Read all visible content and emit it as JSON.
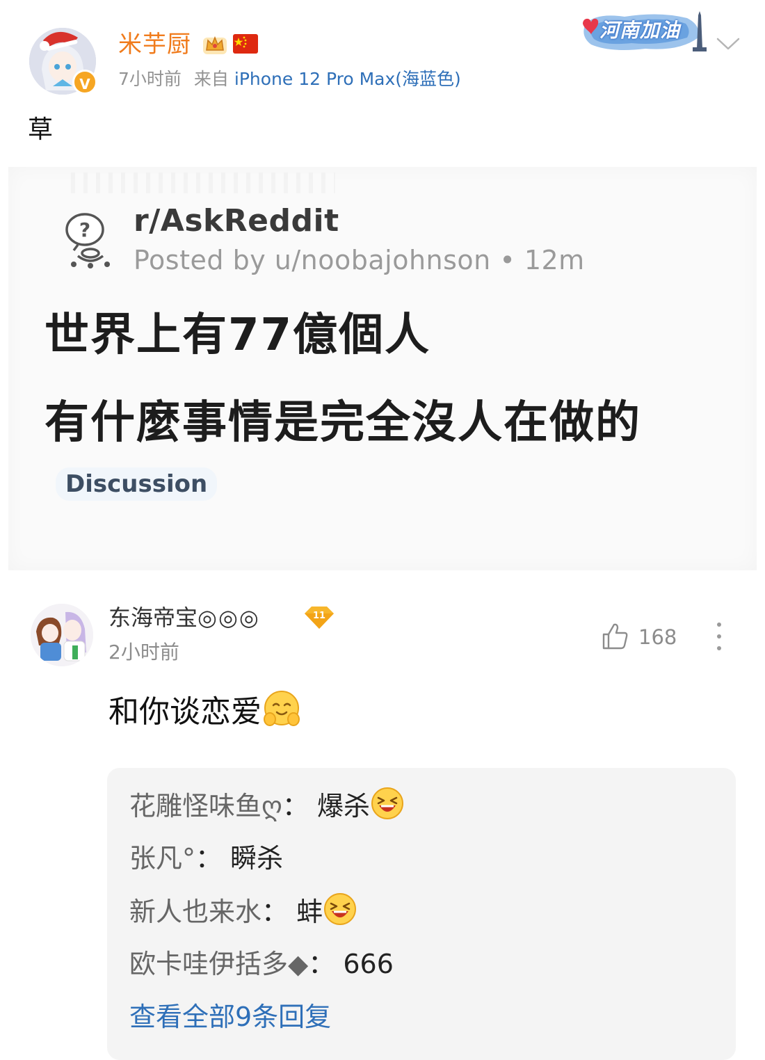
{
  "post": {
    "author": "米芋厨",
    "time": "7小时前",
    "source_prefix": "来自",
    "source_device": "iPhone 12 Pro Max(海蓝色)",
    "badge_text": "河南加油",
    "text": "草",
    "icons": [
      "crown-icon",
      "china-flag-icon",
      "chevron-down-icon",
      "verified-icon"
    ]
  },
  "reddit_image": {
    "subreddit": "r/AskReddit",
    "posted_by": "Posted by u/noobajohnson • 12m",
    "title_line1": "世界上有77億個人",
    "title_line2": "有什麼事情是完全沒人在做的",
    "flair": "Discussion"
  },
  "comment": {
    "author": "东海帝宝",
    "author_suffix": "◎◎◎",
    "level": "11",
    "time": "2小时前",
    "likes": "168",
    "text": "和你谈恋爱",
    "replies": [
      {
        "author": "花雕怪味鱼ღ",
        "sep": "：",
        "text": "爆杀",
        "emoji": true
      },
      {
        "author": "张凡°",
        "sep": "：",
        "text": "瞬杀",
        "emoji": false
      },
      {
        "author": "新人也来水",
        "sep": "：",
        "text": "蚌",
        "emoji": true
      },
      {
        "author": "欧卡哇伊括多◆",
        "sep": "：",
        "text": "666",
        "emoji": false
      }
    ],
    "view_all": "查看全部9条回复"
  },
  "colors": {
    "author_orange": "#f07b1c",
    "link_blue": "#2e6fb8",
    "meta_gray": "#939393"
  }
}
